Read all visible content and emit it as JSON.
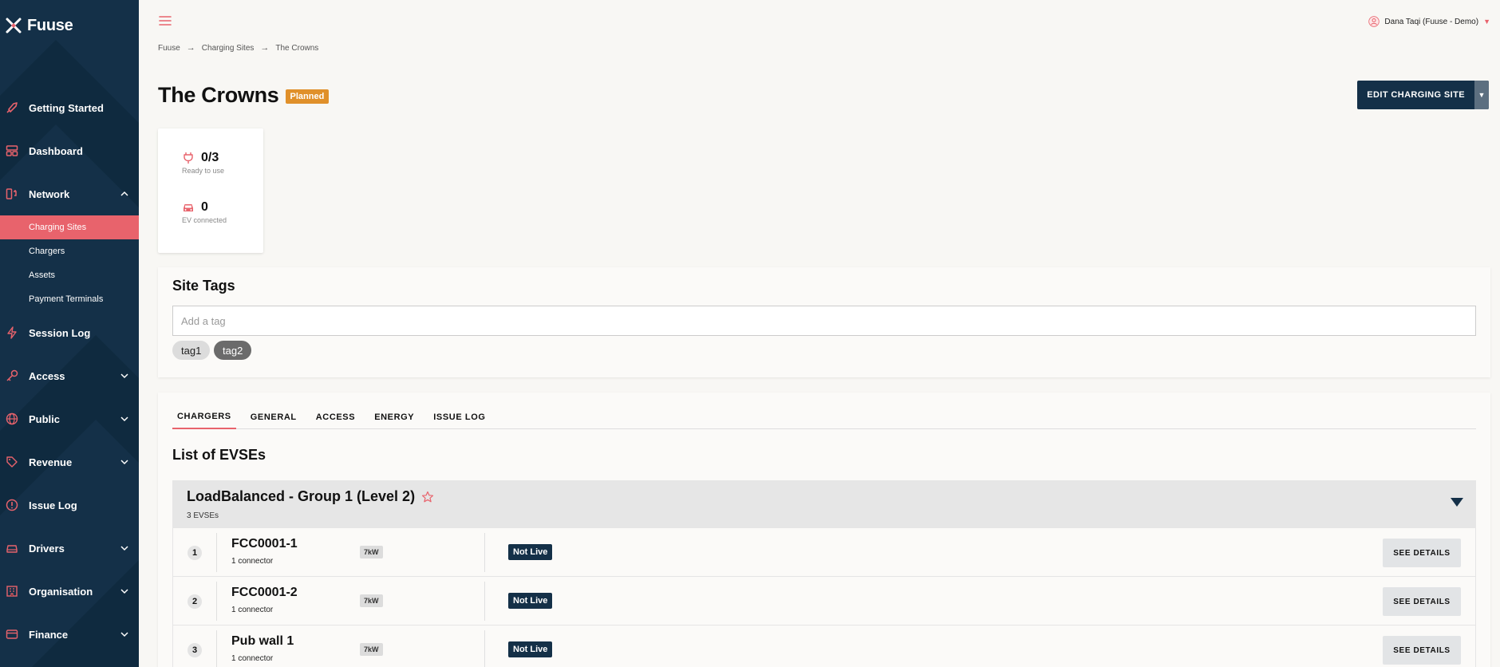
{
  "app": {
    "name": "Fuuse"
  },
  "colors": {
    "sidebar": "#143048",
    "accent": "#e8636c",
    "planned": "#e0902a",
    "primary_button": "#143048"
  },
  "sidebar": {
    "items": [
      {
        "label": "Getting Started",
        "icon": "rocket-icon"
      },
      {
        "label": "Dashboard",
        "icon": "dashboard-icon"
      },
      {
        "label": "Network",
        "icon": "network-icon",
        "expanded": true,
        "children": [
          {
            "label": "Charging Sites",
            "active": true
          },
          {
            "label": "Chargers"
          },
          {
            "label": "Assets"
          },
          {
            "label": "Payment Terminals"
          }
        ]
      },
      {
        "label": "Session Log",
        "icon": "lightning-icon"
      },
      {
        "label": "Access",
        "icon": "key-icon"
      },
      {
        "label": "Public",
        "icon": "globe-icon"
      },
      {
        "label": "Revenue",
        "icon": "tag-icon"
      },
      {
        "label": "Issue Log",
        "icon": "alert-icon"
      },
      {
        "label": "Drivers",
        "icon": "car-icon"
      },
      {
        "label": "Organisation",
        "icon": "building-icon"
      },
      {
        "label": "Finance",
        "icon": "card-icon"
      }
    ]
  },
  "header": {
    "user": "Dana Taqi (Fuuse - Demo)"
  },
  "breadcrumb": [
    "Fuuse",
    "Charging Sites",
    "The Crowns"
  ],
  "page": {
    "title": "The Crowns",
    "status": "Planned",
    "edit_label": "EDIT CHARGING SITE"
  },
  "stats": [
    {
      "value": "0/3",
      "caption": "Ready to use",
      "icon": "plug-icon"
    },
    {
      "value": "0",
      "caption": "EV connected",
      "icon": "car-icon"
    }
  ],
  "site_tags": {
    "title": "Site Tags",
    "placeholder": "Add a tag",
    "tags": [
      "tag1",
      "tag2"
    ]
  },
  "tabs": [
    "CHARGERS",
    "GENERAL",
    "ACCESS",
    "ENERGY",
    "ISSUE LOG"
  ],
  "evse_list": {
    "title": "List of EVSEs",
    "group": {
      "name": "LoadBalanced - Group 1 (Level 2)",
      "count": "3 EVSEs"
    },
    "rows": [
      {
        "num": "1",
        "name": "FCC0001-1",
        "connectors": "1 connector",
        "power": "7kW",
        "status": "Not Live",
        "action": "SEE DETAILS"
      },
      {
        "num": "2",
        "name": "FCC0001-2",
        "connectors": "1 connector",
        "power": "7kW",
        "status": "Not Live",
        "action": "SEE DETAILS"
      },
      {
        "num": "3",
        "name": "Pub wall 1",
        "connectors": "1 connector",
        "power": "7kW",
        "status": "Not Live",
        "action": "SEE DETAILS"
      }
    ]
  }
}
